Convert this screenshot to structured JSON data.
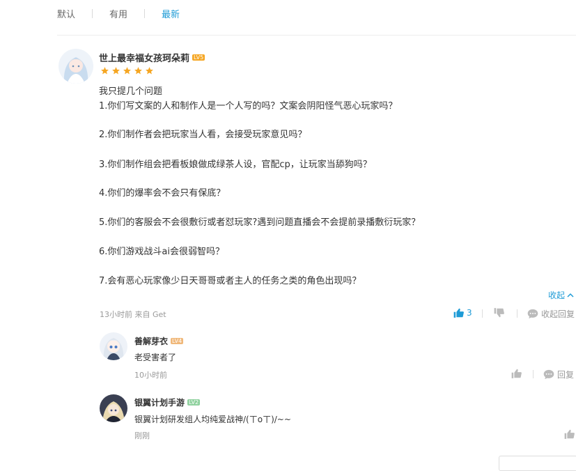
{
  "tabs": [
    {
      "label": "默认",
      "active": false
    },
    {
      "label": "有用",
      "active": false
    },
    {
      "label": "最新",
      "active": true
    }
  ],
  "colors": {
    "accent": "#1e9bd6",
    "star": "#f5a623",
    "lv5": "#f5a623",
    "lv4": "#f0b87a",
    "lv2": "#8fd19e"
  },
  "review": {
    "username": "世上最幸福女孩珂朵莉",
    "level": "LV5",
    "rating": 5,
    "lines": [
      "我只提几个问题",
      "1.你们写文案的人和制作人是一个人写的吗？文案会阴阳怪气恶心玩家吗？",
      "",
      "2.你们制作者会把玩家当人看，会接受玩家意见吗？",
      "",
      "3.你们制作组会把看板娘做成绿茶人设，官配cp，让玩家当舔狗吗？",
      "",
      "4.你们的爆率会不会只有保底？",
      "",
      "5.你们的客服会不会很敷衍或者怼玩家?遇到问题直播会不会提前录播敷衍玩家？",
      "",
      "6.你们游戏战斗ai会很弱智吗？",
      "",
      "7.会有恶心玩家像少日天哥哥或者主人的任务之类的角色出现吗？"
    ],
    "collapse_label": "收起",
    "meta": "13小时前 来自 Get",
    "like_count": "3",
    "collapse_replies_label": "收起回复"
  },
  "replies": [
    {
      "username": "善解芽衣",
      "level": "LV4",
      "text": "老受害者了",
      "time": "10小时前",
      "reply_label": "回复"
    },
    {
      "username": "银翼计划手游",
      "level": "LV2",
      "text": "银翼计划研发组人均纯爱战神/(ㄒoㄒ)/~~",
      "time": "刚刚"
    }
  ]
}
